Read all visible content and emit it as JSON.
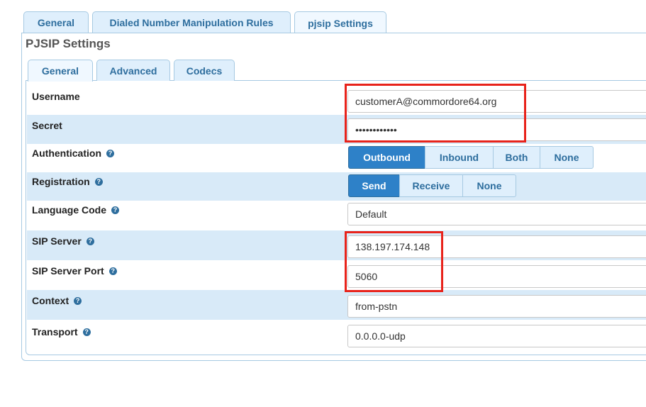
{
  "top_tabs": [
    "General",
    "Dialed Number Manipulation Rules",
    "pjsip Settings"
  ],
  "section_title": "PJSIP Settings",
  "sub_tabs": [
    "General",
    "Advanced",
    "Codecs"
  ],
  "fields": {
    "username": {
      "label": "Username",
      "value": "customerA@commordore64.org"
    },
    "secret": {
      "label": "Secret",
      "value": "••••••••••••"
    },
    "authentication": {
      "label": "Authentication",
      "options": [
        "Outbound",
        "Inbound",
        "Both",
        "None"
      ],
      "selected": "Outbound"
    },
    "registration": {
      "label": "Registration",
      "options": [
        "Send",
        "Receive",
        "None"
      ],
      "selected": "Send"
    },
    "language_code": {
      "label": "Language Code",
      "value": "Default"
    },
    "sip_server": {
      "label": "SIP Server",
      "value": "138.197.174.148"
    },
    "sip_server_port": {
      "label": "SIP Server Port",
      "value": "5060"
    },
    "context": {
      "label": "Context",
      "value": "from-pstn"
    },
    "transport": {
      "label": "Transport",
      "value": "0.0.0.0-udp"
    }
  },
  "help_glyph": "?",
  "colors": {
    "highlight_box": "#e8231b",
    "tab_text": "#2e6e9e",
    "active_segment": "#2e81c8",
    "alt_row": "#d8eaf8"
  }
}
